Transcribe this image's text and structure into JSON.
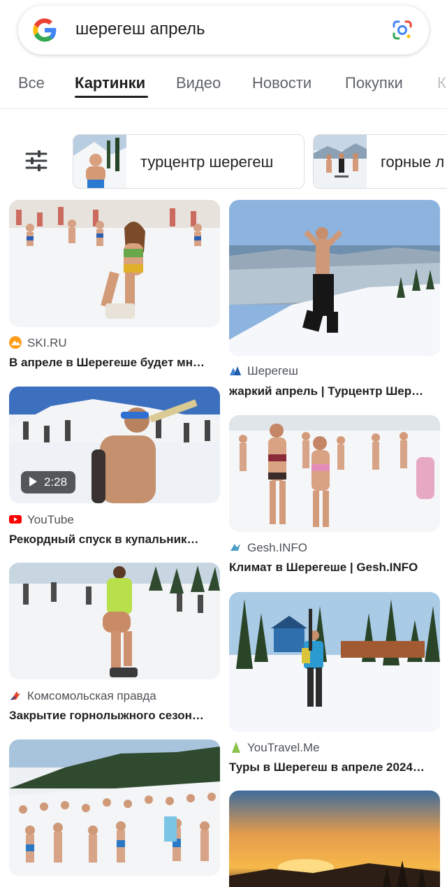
{
  "search": {
    "query": "шерегеш апрель"
  },
  "tabs": [
    {
      "label": "Все"
    },
    {
      "label": "Картинки"
    },
    {
      "label": "Видео"
    },
    {
      "label": "Новости"
    },
    {
      "label": "Покупки"
    },
    {
      "label": "К"
    }
  ],
  "chips": [
    {
      "label": "турцентр шерегеш"
    },
    {
      "label": "горные л"
    }
  ],
  "results": [
    {
      "source": "SKI.RU",
      "title": "В апреле в Шерегеше будет мн…",
      "source_icon": "ski-ru-icon"
    },
    {
      "source": "Шерегеш",
      "title": "жаркий апрель | Турцентр Шер…",
      "source_icon": "sheregesh-icon"
    },
    {
      "source": "YouTube",
      "title": "Рекордный спуск в купальник…",
      "source_icon": "youtube-icon",
      "duration": "2:28"
    },
    {
      "source": "Gesh.INFO",
      "title": "Климат в Шерегеше | Gesh.INFO",
      "source_icon": "gesh-info-icon"
    },
    {
      "source": "Комсомольская правда",
      "title": "Закрытие горнолыжного сезон…",
      "source_icon": "kp-icon"
    },
    {
      "source": "YouTravel.Me",
      "title": "Туры в Шерегеш в апреле 2024…",
      "source_icon": "youtravel-icon"
    }
  ],
  "colors": {
    "accent": "#1f1f1f",
    "muted": "#5f6368",
    "youtube": "#ff0000"
  }
}
